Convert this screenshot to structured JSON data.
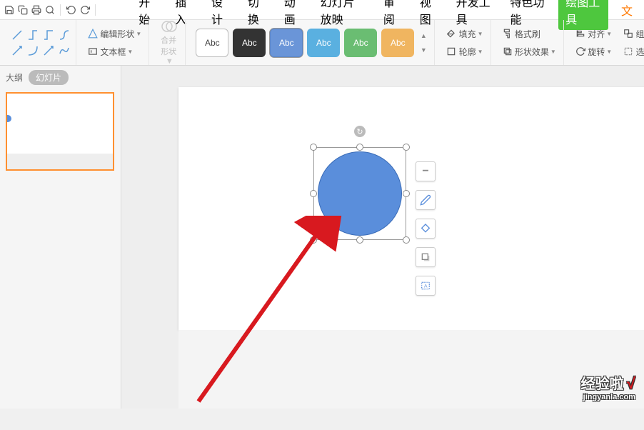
{
  "tabs": {
    "start": "开始",
    "insert": "插入",
    "design": "设计",
    "transition": "切换",
    "animation": "动画",
    "slideshow": "幻灯片放映",
    "review": "审阅",
    "view": "视图",
    "dev": "开发工具",
    "special": "特色功能",
    "drawtool": "绘图工具",
    "more": "文"
  },
  "ribbon": {
    "edit_shape": "编辑形状",
    "textbox": "文本框",
    "merge": "合并形状",
    "preset_label": "Abc",
    "fill": "填充",
    "format_painter": "格式刷",
    "outline": "轮廓",
    "effects": "形状效果",
    "align": "对齐",
    "group": "组合",
    "rotate": "旋转",
    "select": "选择"
  },
  "side": {
    "outline": "大纲",
    "slides": "幻灯片"
  },
  "watermark": {
    "brand": "经验啦",
    "url": "jingyanla.com",
    "check": "√"
  }
}
